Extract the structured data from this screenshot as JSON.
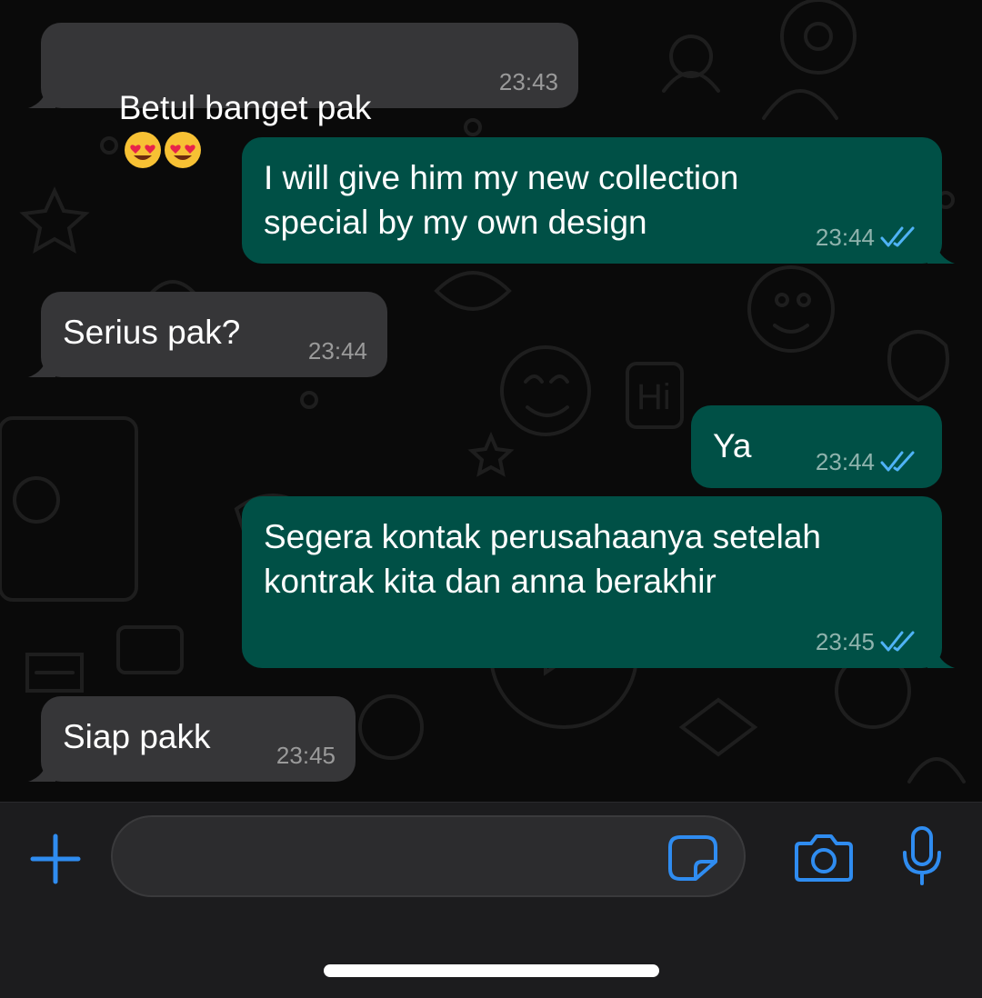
{
  "messages": [
    {
      "direction": "in",
      "text": "Betul banget pak",
      "emoji": "heart-eyes-emoji ×2",
      "time": "23:43"
    },
    {
      "direction": "out",
      "text": "I will give him my new collection\nspecial by my own design",
      "time": "23:44",
      "status": "read"
    },
    {
      "direction": "in",
      "text": "Serius pak?",
      "time": "23:44"
    },
    {
      "direction": "out",
      "text": "Ya",
      "time": "23:44",
      "status": "read"
    },
    {
      "direction": "out",
      "text": "Segera kontak perusahaanya setelah\nkontrak kita dan anna berakhir",
      "time": "23:45",
      "status": "read"
    },
    {
      "direction": "in",
      "text": "Siap pakk",
      "time": "23:45"
    }
  ],
  "input": {
    "placeholder": "",
    "value": ""
  },
  "icons": {
    "attach": "plus-icon",
    "sticker": "sticker-icon",
    "camera": "camera-icon",
    "mic": "microphone-icon",
    "read_receipt": "double-check-icon"
  },
  "colors": {
    "incoming_bubble": "#363638",
    "outgoing_bubble": "#005046",
    "accent": "#2f8cf0",
    "read_ticks": "#4fb3f6",
    "background": "#0a0a0a"
  }
}
